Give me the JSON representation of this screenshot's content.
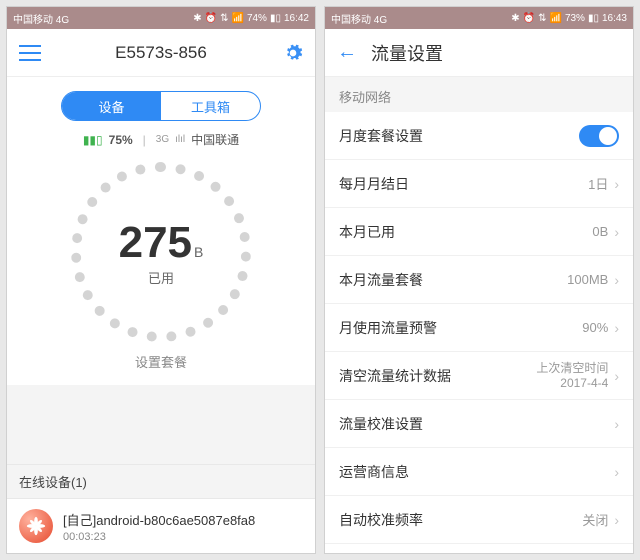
{
  "left": {
    "status": {
      "carrier": "中国移动 4G",
      "batt": "74%",
      "time": "16:42"
    },
    "title": "E5573s-856",
    "tabs": {
      "device": "设备",
      "toolbox": "工具箱"
    },
    "battery": {
      "pct": "75%",
      "net3g": "3G",
      "signal": "ılıl",
      "op": "中国联通"
    },
    "dial": {
      "value": "275",
      "unit": "B",
      "used": "已用"
    },
    "set_plan": "设置套餐",
    "online_header": "在线设备(1)",
    "device": {
      "name": "[自己]android-b80c6ae5087e8fa8",
      "duration": "00:03:23"
    }
  },
  "right": {
    "status": {
      "carrier": "中国移动 4G",
      "batt": "73%",
      "time": "16:43"
    },
    "title": "流量设置",
    "group": "移动网络",
    "cells": {
      "monthly_plan": {
        "label": "月度套餐设置"
      },
      "bill_day": {
        "label": "每月月结日",
        "value": "1日"
      },
      "used_month": {
        "label": "本月已用",
        "value": "0B"
      },
      "plan_month": {
        "label": "本月流量套餐",
        "value": "100MB"
      },
      "warn": {
        "label": "月使用流量预警",
        "value": "90%"
      },
      "clear": {
        "label": "清空流量统计数据",
        "sub1": "上次清空时间",
        "sub2": "2017-4-4"
      },
      "calib": {
        "label": "流量校准设置"
      },
      "op_info": {
        "label": "运营商信息"
      },
      "auto_freq": {
        "label": "自动校准频率",
        "value": "关闭"
      }
    }
  }
}
